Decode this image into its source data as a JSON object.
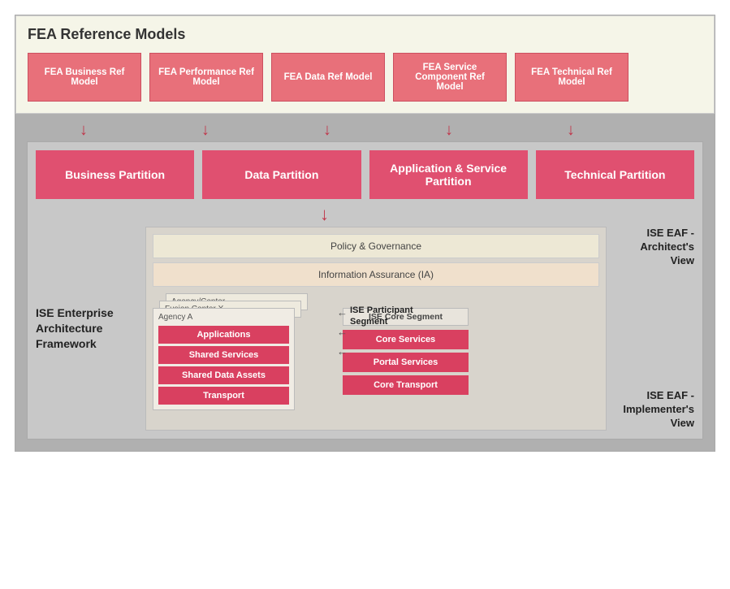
{
  "fea_section": {
    "title": "FEA Reference Models",
    "boxes": [
      {
        "id": "fea-business",
        "label": "FEA Business Ref Model"
      },
      {
        "id": "fea-performance",
        "label": "FEA Performance Ref Model"
      },
      {
        "id": "fea-data",
        "label": "FEA Data Ref Model"
      },
      {
        "id": "fea-service",
        "label": "FEA Service Component Ref Model"
      },
      {
        "id": "fea-technical",
        "label": "FEA Technical Ref Model"
      }
    ]
  },
  "partitions": [
    {
      "id": "business-partition",
      "label": "Business Partition"
    },
    {
      "id": "data-partition",
      "label": "Data Partition"
    },
    {
      "id": "app-service-partition",
      "label": "Application & Service Partition"
    },
    {
      "id": "technical-partition",
      "label": "Technical Partition"
    }
  ],
  "ise_eaf_architect": "ISE EAF - Architect's View",
  "ise_eaf_implementer": "ISE EAF - Implementer's View",
  "ise_framework_label": "ISE Enterprise Architecture Framework",
  "layers": {
    "policy": "Policy & Governance",
    "ia": "Information Assurance (IA)"
  },
  "participant_segment": {
    "label": "ISE Participant Segment",
    "papers": [
      {
        "title": "Agency/Center ..."
      },
      {
        "title": "Fusion Center X"
      },
      {
        "title": "Agency A"
      }
    ],
    "boxes": [
      {
        "label": "Applications"
      },
      {
        "label": "Shared Services"
      },
      {
        "label": "Shared Data Assets"
      },
      {
        "label": "Transport"
      }
    ]
  },
  "core_segment": {
    "label": "ISE Core Segment",
    "boxes": [
      {
        "label": "Core Services"
      },
      {
        "label": "Portal Services"
      },
      {
        "label": "Core Transport"
      }
    ]
  }
}
